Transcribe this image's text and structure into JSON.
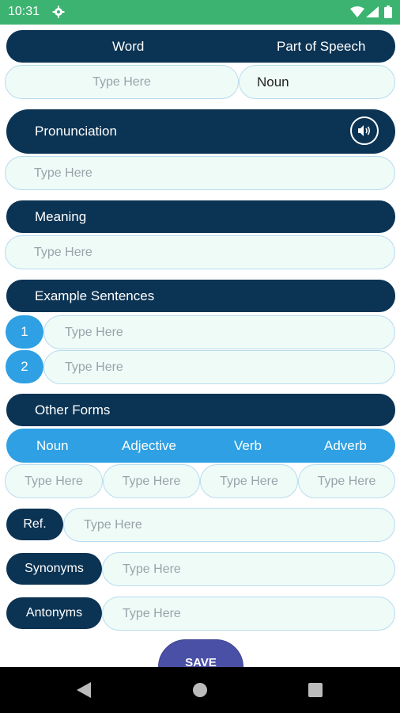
{
  "status_bar": {
    "time": "10:31"
  },
  "word_section": {
    "word_label": "Word",
    "pos_label": "Part of Speech",
    "word_placeholder": "Type Here",
    "pos_value": "Noun"
  },
  "pronunciation": {
    "label": "Pronunciation",
    "placeholder": "Type Here"
  },
  "meaning": {
    "label": "Meaning",
    "placeholder": "Type Here"
  },
  "examples": {
    "label": "Example Sentences",
    "items": [
      {
        "number": "1",
        "placeholder": "Type Here"
      },
      {
        "number": "2",
        "placeholder": "Type Here"
      }
    ]
  },
  "other_forms": {
    "label": "Other Forms",
    "tabs": [
      "Noun",
      "Adjective",
      "Verb",
      "Adverb"
    ],
    "placeholders": [
      "Type Here",
      "Type Here",
      "Type Here",
      "Type Here"
    ]
  },
  "ref": {
    "label": "Ref.",
    "placeholder": "Type Here"
  },
  "synonyms": {
    "label": "Synonyms",
    "placeholder": "Type Here"
  },
  "antonyms": {
    "label": "Antonyms",
    "placeholder": "Type Here"
  },
  "save_label": "SAVE",
  "colors": {
    "header": "#0b3353",
    "accent": "#2ea0e3",
    "status_bar": "#3cb371",
    "field_bg": "#eefbf7",
    "save_button": "#4a50a6"
  }
}
